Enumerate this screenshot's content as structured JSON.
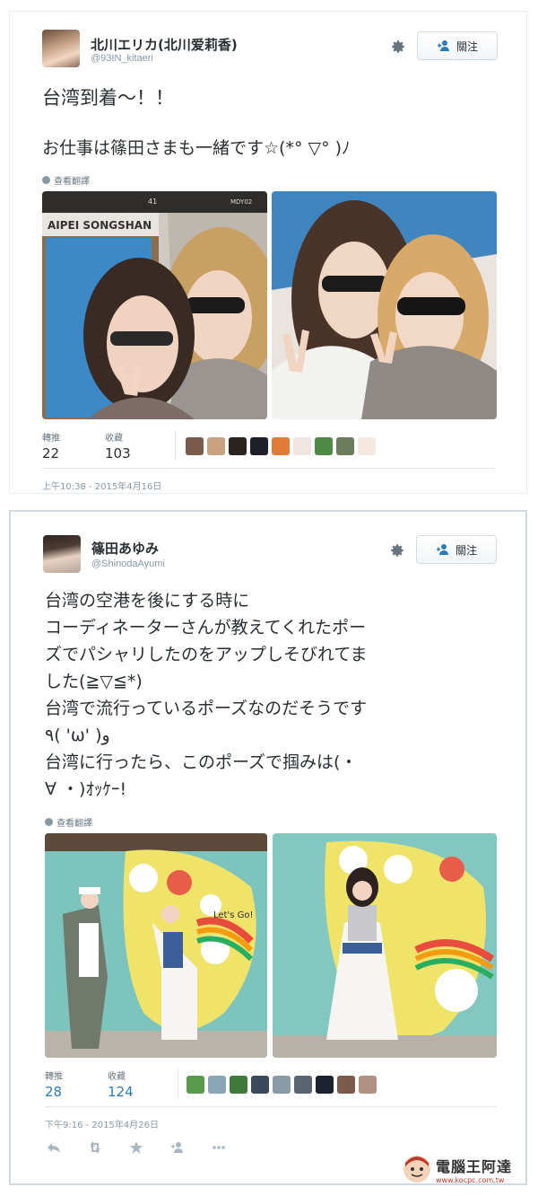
{
  "tweet1": {
    "display_name": "北川エリカ(北川爱莉香)",
    "handle": "@93IN_kitaeri",
    "follow_label": "關注",
    "text_line1": "台湾到着〜！！",
    "text_line2": "お仕事は篠田さまも一緒です☆(*° ▽° )ﾉ",
    "translate_label": "查看翻譯",
    "photo_sign_1": "41",
    "photo_sign_2": "MDY02",
    "photo_sign_3": "AIPEI  SONGSHAN",
    "retweets_label": "轉推",
    "retweets_value": "22",
    "favorites_label": "收藏",
    "favorites_value": "103",
    "timestamp": "上午10:38 - 2015年4月16日",
    "face_colors": [
      "#7a5a48",
      "#c9a27f",
      "#2a2320",
      "#1d1f2a",
      "#e07b39",
      "#efe6e2",
      "#4f8a44",
      "#6e7c5e",
      "#f5e9df"
    ]
  },
  "tweet2": {
    "display_name": "篠田あゆみ",
    "handle": "@ShinodaAyumi",
    "follow_label": "關注",
    "text_lines": [
      "台湾の空港を後にする時に",
      "コーディネーターさんが教えてくれたポー",
      "ズでパシャリしたのをアップしそびれてま",
      "した(≧▽≦*)",
      "台湾で流行っているポーズなのだそうです",
      "٩( 'ω' )و",
      "台湾に行ったら、このポーズで掴みは(・",
      "∀ ・)ｵｯｹｰ!"
    ],
    "translate_label": "查看翻譯",
    "photo_sign": "Let's Go!",
    "retweets_label": "轉推",
    "retweets_value": "28",
    "favorites_label": "收藏",
    "favorites_value": "124",
    "timestamp": "下午9:16 - 2015年4月26日",
    "face_colors": [
      "#5a9a4d",
      "#8aa4b8",
      "#3f7a3a",
      "#3a4a5c",
      "#8a9aa7",
      "#5b6570",
      "#1c2230",
      "#7b5b4a",
      "#b09080"
    ]
  },
  "watermark": {
    "title": "電腦王阿達",
    "url": "www.kocpc.com.tw"
  },
  "colors": {
    "link_blue": "#2b7bb9",
    "muted": "#8899a6",
    "text": "#292f33"
  }
}
